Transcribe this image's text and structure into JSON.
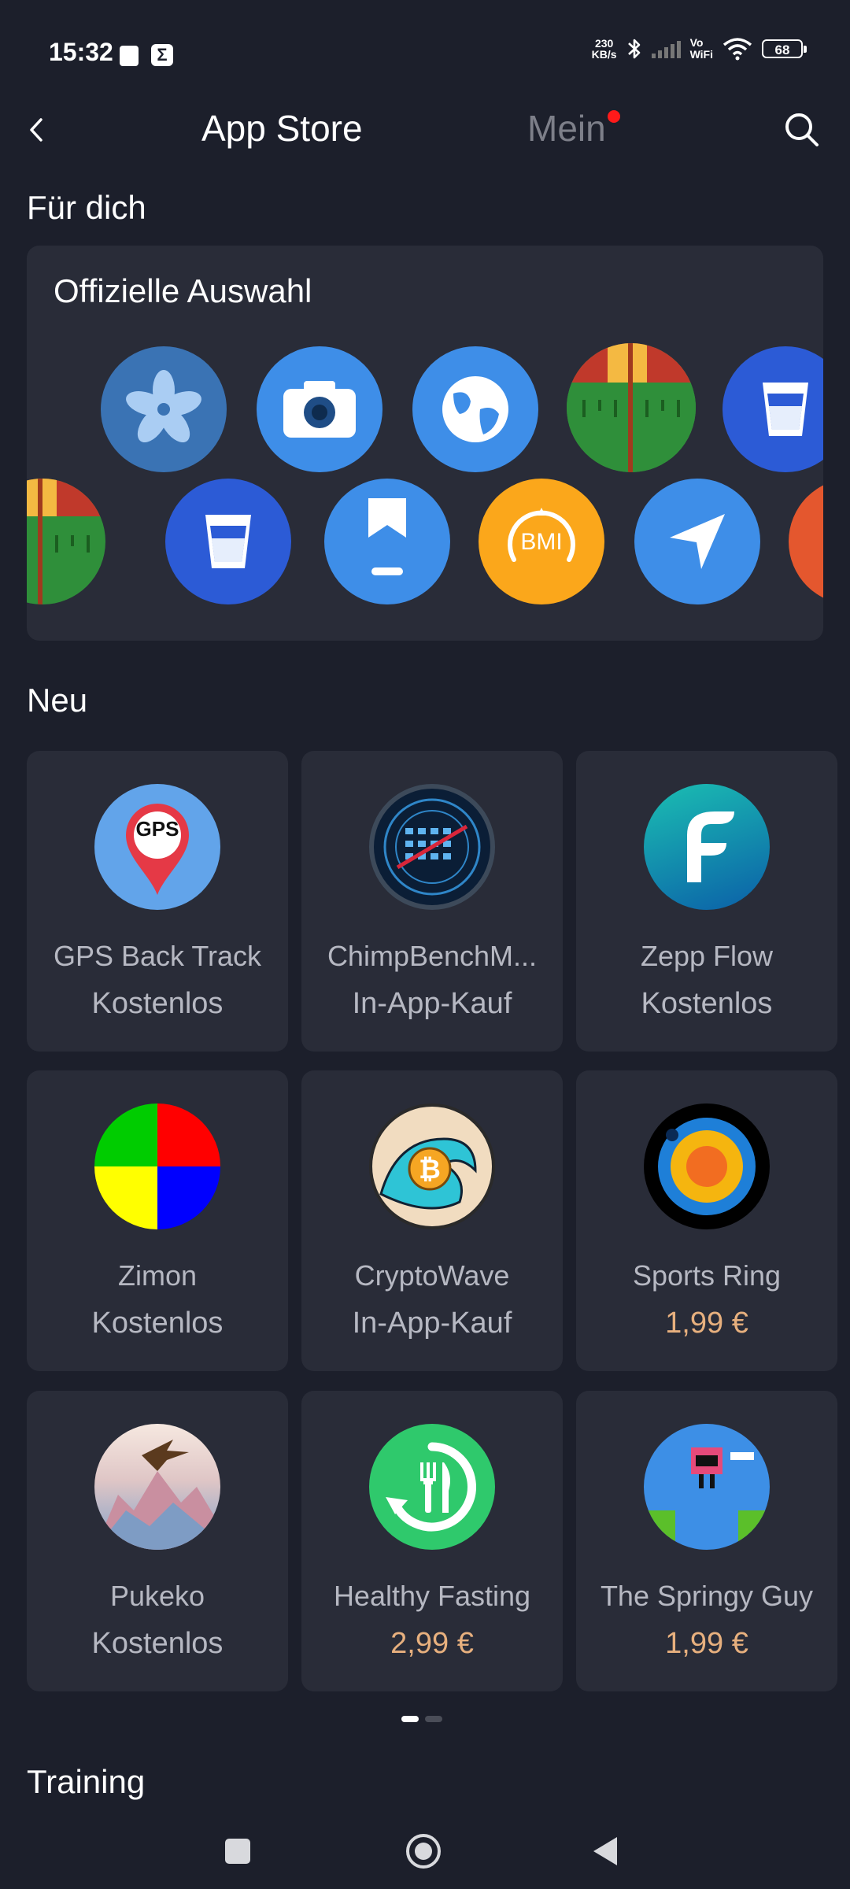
{
  "status_bar": {
    "time": "15:32",
    "speed_value": "230",
    "speed_unit": "KB/s",
    "vowifi_line1": "Vo",
    "vowifi_line2": "WiFi",
    "battery": "68"
  },
  "header": {
    "title": "App Store",
    "tab_mine": "Mein",
    "icons": [
      "back-icon",
      "search-icon"
    ]
  },
  "for_you": {
    "section_title": "Für dich",
    "card_title": "Offizielle Auswahl"
  },
  "new_section": {
    "title": "Neu",
    "apps": [
      {
        "name": "GPS Back Track",
        "price": "Kostenlos"
      },
      {
        "name": "ChimpBenchM...",
        "price": "In-App-Kauf"
      },
      {
        "name": "Zepp Flow",
        "price": "Kostenlos"
      },
      {
        "name": "Zimon",
        "price": "Kostenlos"
      },
      {
        "name": "CryptoWave",
        "price": "In-App-Kauf"
      },
      {
        "name": "Sports Ring",
        "price": "1,99 €"
      },
      {
        "name": "Pukeko",
        "price": "Kostenlos"
      },
      {
        "name": "Healthy Fasting",
        "price": "2,99 €"
      },
      {
        "name": "The Springy Guy",
        "price": "1,99 €"
      }
    ],
    "gps_icon_label": "GPS",
    "bmi_label": "BMI",
    "pager_dots": 2,
    "pager_active": 1
  },
  "training_section": {
    "title": "Training"
  },
  "colors": {
    "background": "#1c1f2b",
    "card": "#292c38",
    "price_paid": "#e7b07e",
    "text_muted": "#b6b8c2",
    "notification_dot": "#ff1a1a"
  }
}
